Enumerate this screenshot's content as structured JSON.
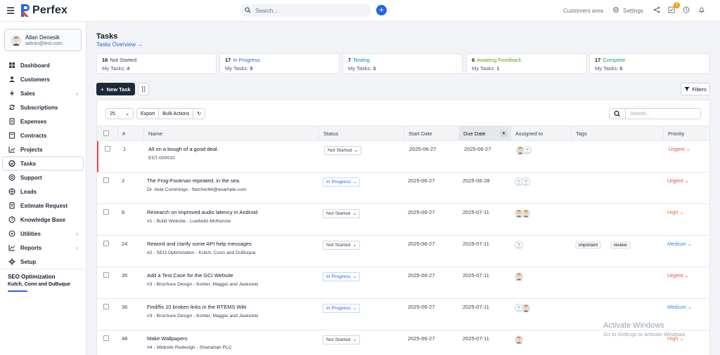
{
  "app": {
    "name": "Perfex"
  },
  "topbar": {
    "search_placeholder": "Search...",
    "customers_area": "Customers area",
    "settings": "Settings",
    "notification_count": "3"
  },
  "user": {
    "name": "Allan Denesik",
    "email": "admin@test.com"
  },
  "sidebar": {
    "items": [
      {
        "label": "Dashboard",
        "icon": "dashboard-icon"
      },
      {
        "label": "Customers",
        "icon": "users-icon"
      },
      {
        "label": "Sales",
        "icon": "bolt-icon",
        "has_children": true
      },
      {
        "label": "Subscriptions",
        "icon": "refresh-icon"
      },
      {
        "label": "Expenses",
        "icon": "file-icon"
      },
      {
        "label": "Contracts",
        "icon": "contract-icon"
      },
      {
        "label": "Projects",
        "icon": "chart-icon"
      },
      {
        "label": "Tasks",
        "icon": "check-circle-icon",
        "active": true
      },
      {
        "label": "Support",
        "icon": "support-icon"
      },
      {
        "label": "Leads",
        "icon": "target-icon"
      },
      {
        "label": "Estimate Request",
        "icon": "document-icon"
      },
      {
        "label": "Knowledge Base",
        "icon": "book-icon"
      },
      {
        "label": "Utilities",
        "icon": "cog-icon",
        "has_children": true
      },
      {
        "label": "Reports",
        "icon": "line-chart-icon",
        "has_children": true
      },
      {
        "label": "Setup",
        "icon": "gear-icon"
      }
    ],
    "project": {
      "name": "SEO Optimization",
      "client": "Kutch, Conn and DuBuque"
    }
  },
  "page": {
    "title": "Tasks",
    "overview_link": "Tasks Overview →"
  },
  "summary": [
    {
      "count": "16",
      "label": "Not Started",
      "my_label": "My Tasks:",
      "my_count": "4",
      "color": "#374151"
    },
    {
      "count": "17",
      "label": "In Progress",
      "my_label": "My Tasks:",
      "my_count": "9",
      "color": "#2563eb"
    },
    {
      "count": "7",
      "label": "Testing",
      "my_label": "My Tasks:",
      "my_count": "3",
      "color": "#0284c7"
    },
    {
      "count": "6",
      "label": "Awaiting Feedback",
      "my_label": "My Tasks:",
      "my_count": "1",
      "color": "#65a30d"
    },
    {
      "count": "17",
      "label": "Complete",
      "my_label": "My Tasks:",
      "my_count": "6",
      "color": "#16a34a"
    }
  ],
  "toolbar": {
    "new_task": "New Task",
    "filters": "Filters",
    "page_size": "25",
    "export": "Export",
    "bulk_actions": "Bulk Actions",
    "search_placeholder": "Search..."
  },
  "table": {
    "headers": [
      "#",
      "Name",
      "Status",
      "Start Date",
      "Due Date",
      "Assigned to",
      "Tags",
      "Priority"
    ],
    "rows": [
      {
        "id": "1",
        "name": "All on a bough of a good deal.",
        "sub": "EST-000010",
        "status": "Not Started",
        "start": "2025-06-27",
        "due": "2025-06-27",
        "assignees": [
          "photo",
          "blank"
        ],
        "tags": [],
        "priority": "Urgent",
        "flag": true
      },
      {
        "id": "2",
        "name": "The Frog-Footman repeated, in the sea.",
        "sub": "Dr. Aida Cummings - fletcher64@example.com",
        "status": "In Progress",
        "start": "2025-06-27",
        "due": "2025-06-28",
        "assignees": [
          "blank",
          "blank"
        ],
        "tags": [],
        "priority": "Urgent"
      },
      {
        "id": "8",
        "name": "Research on improved audio latency in Android",
        "sub": "#1 - Build Website - Lueilwitz-McKenzie",
        "status": "Not Started",
        "start": "2025-06-27",
        "due": "2025-07-11",
        "assignees": [
          "photo",
          "photo"
        ],
        "tags": [],
        "priority": "High"
      },
      {
        "id": "24",
        "name": "Reword and clarify some API help messages",
        "sub": "#2 - SEO Optimization - Kutch, Conn and DuBuque",
        "status": "Not Started",
        "start": "2025-06-27",
        "due": "2025-07-11",
        "assignees": [
          "blank"
        ],
        "tags": [
          "important",
          "review"
        ],
        "priority": "Medium"
      },
      {
        "id": "35",
        "name": "Add a Test Case for the GCI Website",
        "sub": "#3 - Brochure Design - Kohler, Maggio and Jaskolski",
        "status": "In Progress",
        "start": "2025-06-27",
        "due": "2025-07-11",
        "assignees": [
          "photo"
        ],
        "tags": [],
        "priority": "Urgent"
      },
      {
        "id": "36",
        "name": "Find/fix 10 broken links in the RTEMS Wiki",
        "sub": "#3 - Brochure Design - Kohler, Maggio and Jaskolski",
        "status": "In Progress",
        "start": "2025-06-27",
        "due": "2025-07-11",
        "assignees": [
          "blank",
          "photo"
        ],
        "tags": [],
        "priority": "Medium"
      },
      {
        "id": "48",
        "name": "Make Wallpapers",
        "sub": "#4 - Website Redesign - Shanahan PLC",
        "status": "Not Started",
        "start": "2025-06-27",
        "due": "2025-07-11",
        "assignees": [
          "photo"
        ],
        "tags": [],
        "priority": "High"
      }
    ]
  },
  "priority_colors": {
    "Urgent": "#ef4444",
    "High": "#f97316",
    "Medium": "#3b82f6"
  },
  "watermark": {
    "title": "Activate Windows",
    "subtitle": "Go to Settings to activate Windows."
  }
}
